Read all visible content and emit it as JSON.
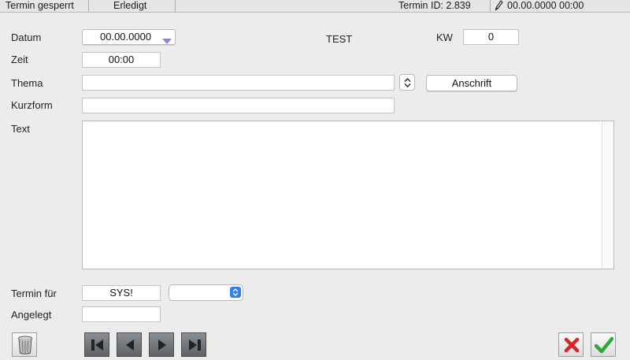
{
  "topbar": {
    "status_locked": "Termin gesperrt",
    "status_done": "Erledigt",
    "termin_id": "Termin ID: 2.839",
    "edit_timestamp": "00.00.0000 00:00"
  },
  "form": {
    "datum_label": "Datum",
    "datum_value": "00.00.0000",
    "test_label": "TEST",
    "kw_label": "KW",
    "kw_value": "0",
    "zeit_label": "Zeit",
    "zeit_value": "00:00",
    "thema_label": "Thema",
    "thema_value": "",
    "anschrift_button": "Anschrift",
    "kurzform_label": "Kurzform",
    "kurzform_value": "",
    "text_label": "Text",
    "text_value": "",
    "termin_fuer_label": "Termin für",
    "termin_fuer_value": "SYS!",
    "termin_fuer_select": "",
    "angelegt_label": "Angelegt",
    "angelegt_value": ""
  },
  "icons": {
    "edit": "pencil-icon",
    "date_dropdown": "chevron-down-icon",
    "thema_stepper": "up-down-arrows-icon",
    "delete": "trash-icon",
    "first": "first-record-icon",
    "prev": "previous-record-icon",
    "next": "next-record-icon",
    "last": "last-record-icon",
    "cancel": "red-x-icon",
    "confirm": "green-check-icon"
  },
  "colors": {
    "accent_blue": "#2f7cf6",
    "cancel_red": "#d8262b",
    "confirm_green": "#2fa83a",
    "dropdown_triangle": "#8a86e6"
  }
}
